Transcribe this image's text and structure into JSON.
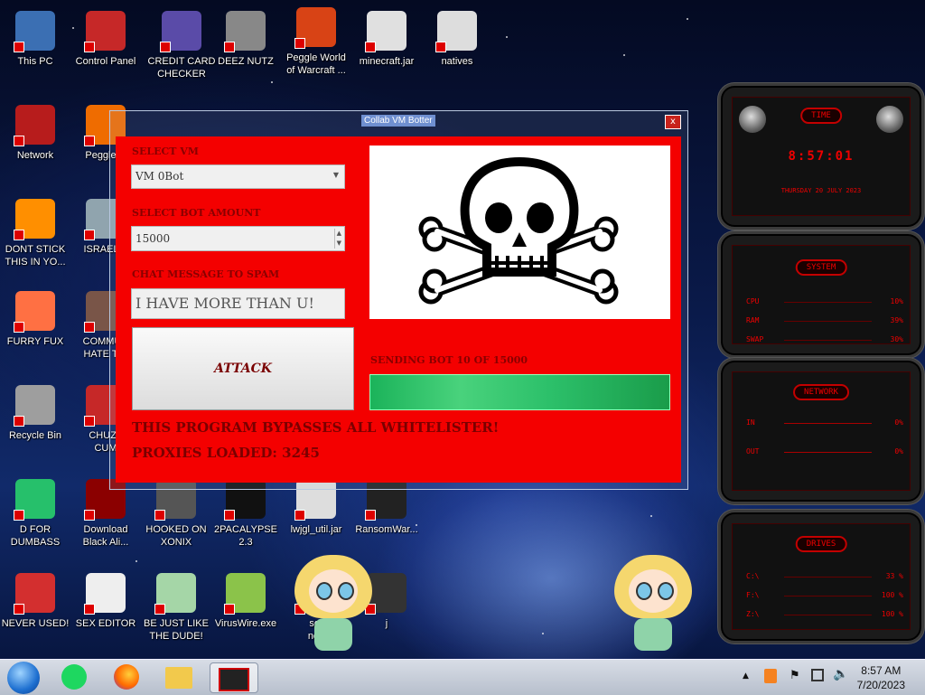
{
  "desktop": {
    "icons": [
      {
        "label": "This PC"
      },
      {
        "label": "Control Panel"
      },
      {
        "label": "CREDIT CARD\nCHECKER"
      },
      {
        "label": "DEEZ NUTZ"
      },
      {
        "label": "Peggle World\nof Warcraft ..."
      },
      {
        "label": "minecraft.jar"
      },
      {
        "label": "natives"
      },
      {
        "label": "Network"
      },
      {
        "label": "Peggle D"
      },
      {
        "label": "DONT STICK\nTHIS IN YO..."
      },
      {
        "label": "ISRAEL S"
      },
      {
        "label": "FURRY FUX"
      },
      {
        "label": "COMMUN\nHATE THI"
      },
      {
        "label": "Recycle Bin"
      },
      {
        "label": "CHUZZ\nCUM"
      },
      {
        "label": "D FOR\nDUMBASS"
      },
      {
        "label": "Download\nBlack Ali..."
      },
      {
        "label": "HOOKED ON\nXONIX"
      },
      {
        "label": "2PACALYPSE\n2.3"
      },
      {
        "label": "lwjgl_util.jar"
      },
      {
        "label": "RansomWar..."
      },
      {
        "label": "NEVER USED!"
      },
      {
        "label": "SEX EDITOR"
      },
      {
        "label": "BE JUST LIKE\nTHE DUDE!"
      },
      {
        "label": "VirusWire.exe"
      },
      {
        "label": "sor\nnee"
      },
      {
        "label": "j"
      }
    ]
  },
  "bot_window": {
    "title": "Collab VM Botter",
    "close": "x",
    "select_vm_label": "SELECT VM",
    "select_vm_value": "VM 0Bot",
    "bot_amount_label": "SELECT BOT AMOUNT",
    "bot_amount_value": "15000",
    "chat_label": "CHAT MESSAGE TO SPAM",
    "chat_value": "I HAVE MORE THAN U!",
    "attack_label": "ATTACK",
    "status": "SENDING BOT 10 OF 15000",
    "progress_fraction": 1.0,
    "bypass_text": "THIS PROGRAM BYPASSES ALL WHITELISTER!",
    "proxies_text": "PROXIES LOADED: 3245"
  },
  "gadgets": {
    "time": {
      "header": "TIME",
      "clock": "8:57:01",
      "date": "THURSDAY 20 JULY 2023"
    },
    "system": {
      "header": "SYSTEM",
      "rows": [
        {
          "label": "CPU",
          "value": "10%"
        },
        {
          "label": "RAM",
          "value": "39%"
        },
        {
          "label": "SWAP",
          "value": "30%"
        }
      ]
    },
    "network": {
      "header": "NETWORK",
      "rows": [
        {
          "label": "IN",
          "value": "0%"
        },
        {
          "label": "OUT",
          "value": "0%"
        }
      ]
    },
    "drives": {
      "header": "DRIVES",
      "rows": [
        {
          "label": "C:\\",
          "value": "33 %"
        },
        {
          "label": "F:\\",
          "value": "100 %"
        },
        {
          "label": "Z:\\",
          "value": "100 %"
        }
      ]
    }
  },
  "taskbar": {
    "time": "8:57 AM",
    "date": "7/20/2023"
  },
  "colors": {
    "panel_red": "#f40000",
    "dark_red": "#7a0000",
    "gadget_red": "#e00000"
  }
}
